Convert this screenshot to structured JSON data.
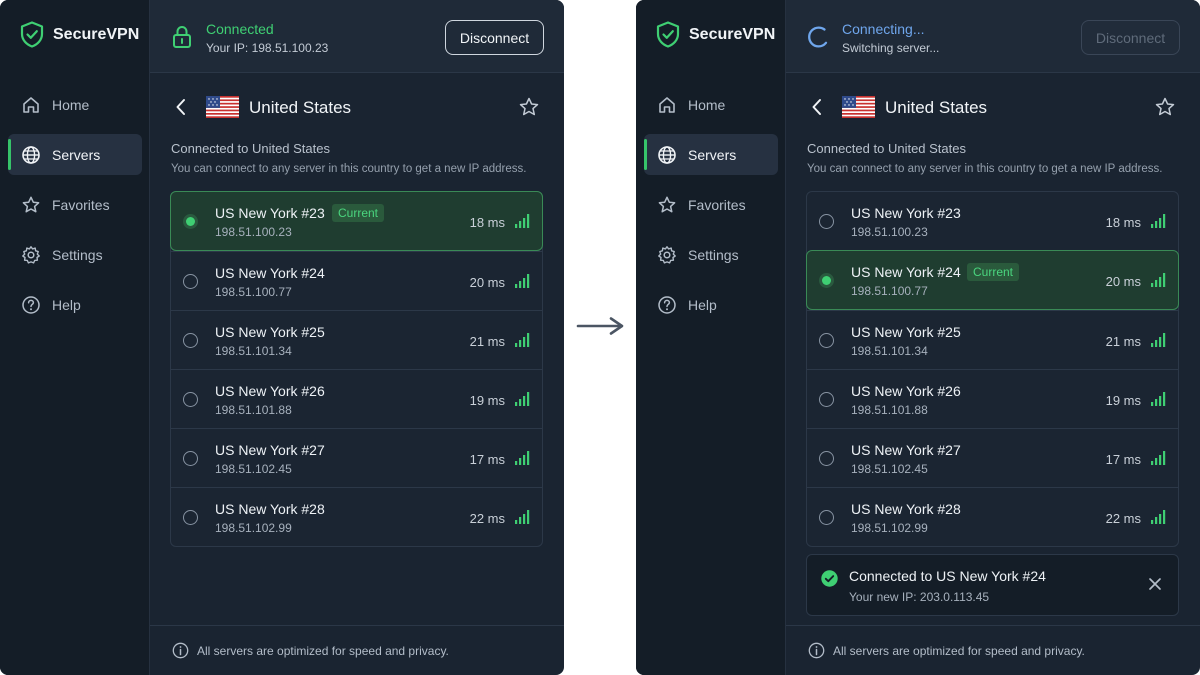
{
  "brand": {
    "name": "SecureVPN"
  },
  "nav": [
    {
      "id": "home",
      "label": "Home",
      "icon": "home-icon"
    },
    {
      "id": "servers",
      "label": "Servers",
      "icon": "globe-icon",
      "active": true
    },
    {
      "id": "favorites",
      "label": "Favorites",
      "icon": "star-icon"
    },
    {
      "id": "settings",
      "label": "Settings",
      "icon": "gear-icon"
    },
    {
      "id": "help",
      "label": "Help",
      "icon": "help-icon"
    }
  ],
  "colors": {
    "accent_green": "#3fcf73",
    "accent_blue": "#6fa6ec",
    "bg": "#1a2431",
    "sidebar": "#141d27"
  },
  "country": {
    "name": "United States",
    "flag_icon": "us-flag-icon"
  },
  "connected_title": "Connected to United States",
  "connected_desc": "You can connect to any server in this country to get a new IP address.",
  "current_badge": "Current",
  "footer_text": "All servers are optimized for speed and privacy.",
  "before": {
    "status_title": "Connected",
    "status_sub": "Your IP: 198.51.100.23",
    "button_label": "Disconnect",
    "button_disabled": false,
    "servers": [
      {
        "name": "US New York #23",
        "ip": "198.51.100.23",
        "ping": "18 ms",
        "selected": true
      },
      {
        "name": "US New York #24",
        "ip": "198.51.100.77",
        "ping": "20 ms",
        "selected": false
      },
      {
        "name": "US New York #25",
        "ip": "198.51.101.34",
        "ping": "21 ms",
        "selected": false
      },
      {
        "name": "US New York #26",
        "ip": "198.51.101.88",
        "ping": "19 ms",
        "selected": false
      },
      {
        "name": "US New York #27",
        "ip": "198.51.102.45",
        "ping": "17 ms",
        "selected": false
      },
      {
        "name": "US New York #28",
        "ip": "198.51.102.99",
        "ping": "22 ms",
        "selected": false
      }
    ]
  },
  "after": {
    "status_title": "Connecting...",
    "status_sub": "Switching server...",
    "button_label": "Disconnect",
    "button_disabled": true,
    "servers": [
      {
        "name": "US New York #23",
        "ip": "198.51.100.23",
        "ping": "18 ms",
        "selected": false
      },
      {
        "name": "US New York #24",
        "ip": "198.51.100.77",
        "ping": "20 ms",
        "selected": true
      },
      {
        "name": "US New York #25",
        "ip": "198.51.101.34",
        "ping": "21 ms",
        "selected": false
      },
      {
        "name": "US New York #26",
        "ip": "198.51.101.88",
        "ping": "19 ms",
        "selected": false
      },
      {
        "name": "US New York #27",
        "ip": "198.51.102.45",
        "ping": "17 ms",
        "selected": false
      },
      {
        "name": "US New York #28",
        "ip": "198.51.102.99",
        "ping": "22 ms",
        "selected": false
      }
    ],
    "toast": {
      "title": "Connected to US New York #24",
      "sub": "Your new IP:  203.0.113.45"
    }
  }
}
